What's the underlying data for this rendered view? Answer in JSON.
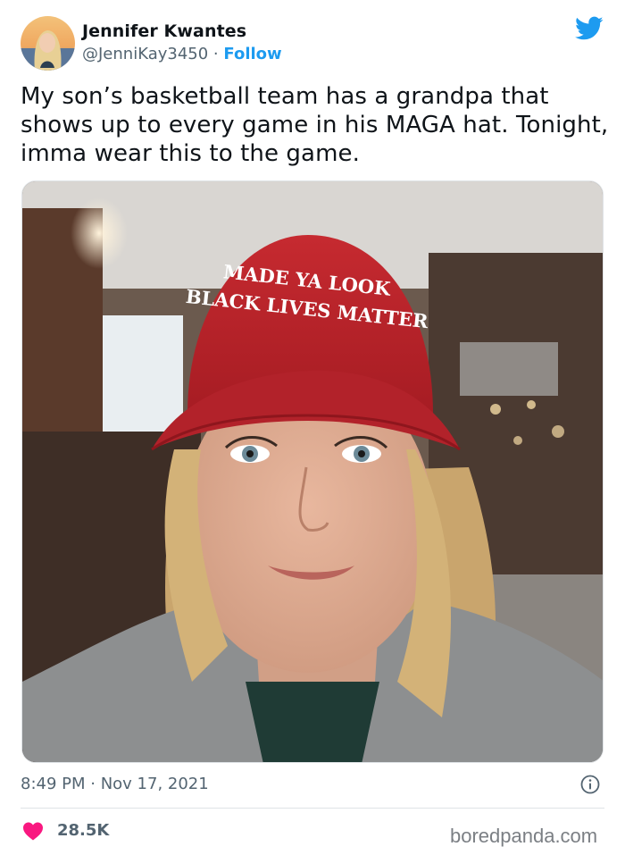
{
  "author": {
    "name": "Jennifer Kwantes",
    "handle": "@JenniKay3450",
    "separator": "·",
    "follow_label": "Follow"
  },
  "tweet": {
    "text_lines": [
      "My son’s basketball team has a grandpa that",
      "shows up to every game in his MAGA hat.  Tonight,",
      "imma wear this to the game."
    ]
  },
  "photo": {
    "hat_text_line1": "MADE YA LOOK",
    "hat_text_line2": "BLACK LIVES MATTER"
  },
  "meta": {
    "timestamp": "8:49 PM · Nov 17, 2021"
  },
  "stats": {
    "likes": "28.5K"
  },
  "watermark": "boredpanda.com",
  "colors": {
    "brand_blue": "#1d9bf0",
    "like_red": "#f91880",
    "muted": "#536471",
    "hat_red": "#c8232c"
  },
  "icons": [
    "twitter-bird-icon",
    "info-icon",
    "heart-icon"
  ]
}
